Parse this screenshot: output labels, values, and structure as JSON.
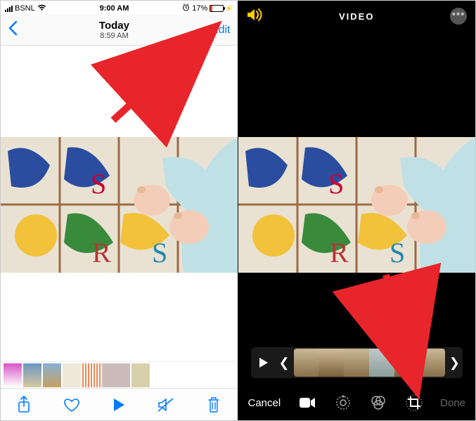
{
  "left": {
    "status": {
      "carrier": "BSNL",
      "time": "9:00 AM",
      "battery_text": "17%"
    },
    "nav": {
      "title": "Today",
      "subtitle": "8:59 AM",
      "edit": "Edit"
    },
    "toolbar": {
      "share": "share-icon",
      "favorite": "heart-icon",
      "play": "play-icon",
      "mute": "mute-icon",
      "delete": "trash-icon"
    }
  },
  "right": {
    "header": {
      "title": "VIDEO"
    },
    "footer": {
      "cancel": "Cancel",
      "done": "Done"
    }
  }
}
